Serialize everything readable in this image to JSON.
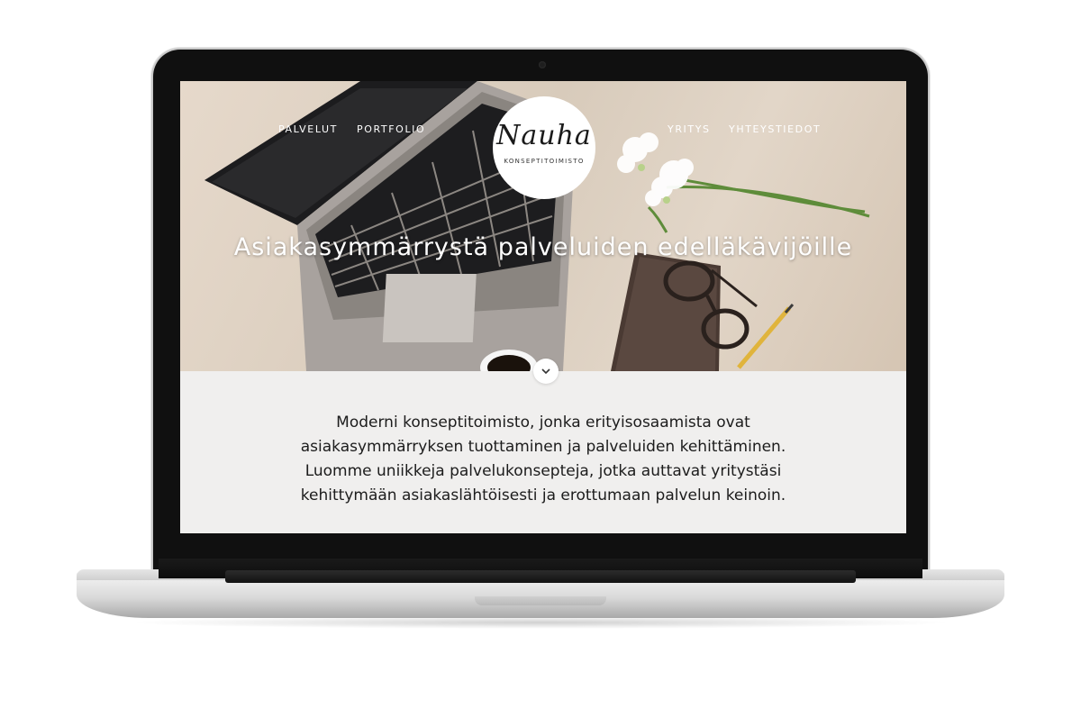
{
  "nav": {
    "left": [
      "PALVELUT",
      "PORTFOLIO"
    ],
    "right": [
      "YRITYS",
      "YHTEYSTIEDOT"
    ]
  },
  "logo": {
    "script": "Nauha",
    "subtitle": "KONSEPTITOIMISTO"
  },
  "hero": {
    "title": "Asiakasymmärrystä palveluiden edelläkävijöille",
    "scroll_icon": "chevron-down-icon"
  },
  "intro": {
    "text": "Moderni konseptitoimisto, jonka erityisosaamista ovat asiakasymmärryksen tuottaminen ja palveluiden kehittäminen. Luomme uniikkeja palvelukonsepteja, jotka auttavat yritystäsi kehittymään asiakaslähtöisesti ja erottumaan palvelun keinoin."
  },
  "colors": {
    "hero_bg": "#dccfc0",
    "intro_bg": "#f0efee",
    "text": "#1c1c1c",
    "laptop_bezel": "#101010"
  }
}
